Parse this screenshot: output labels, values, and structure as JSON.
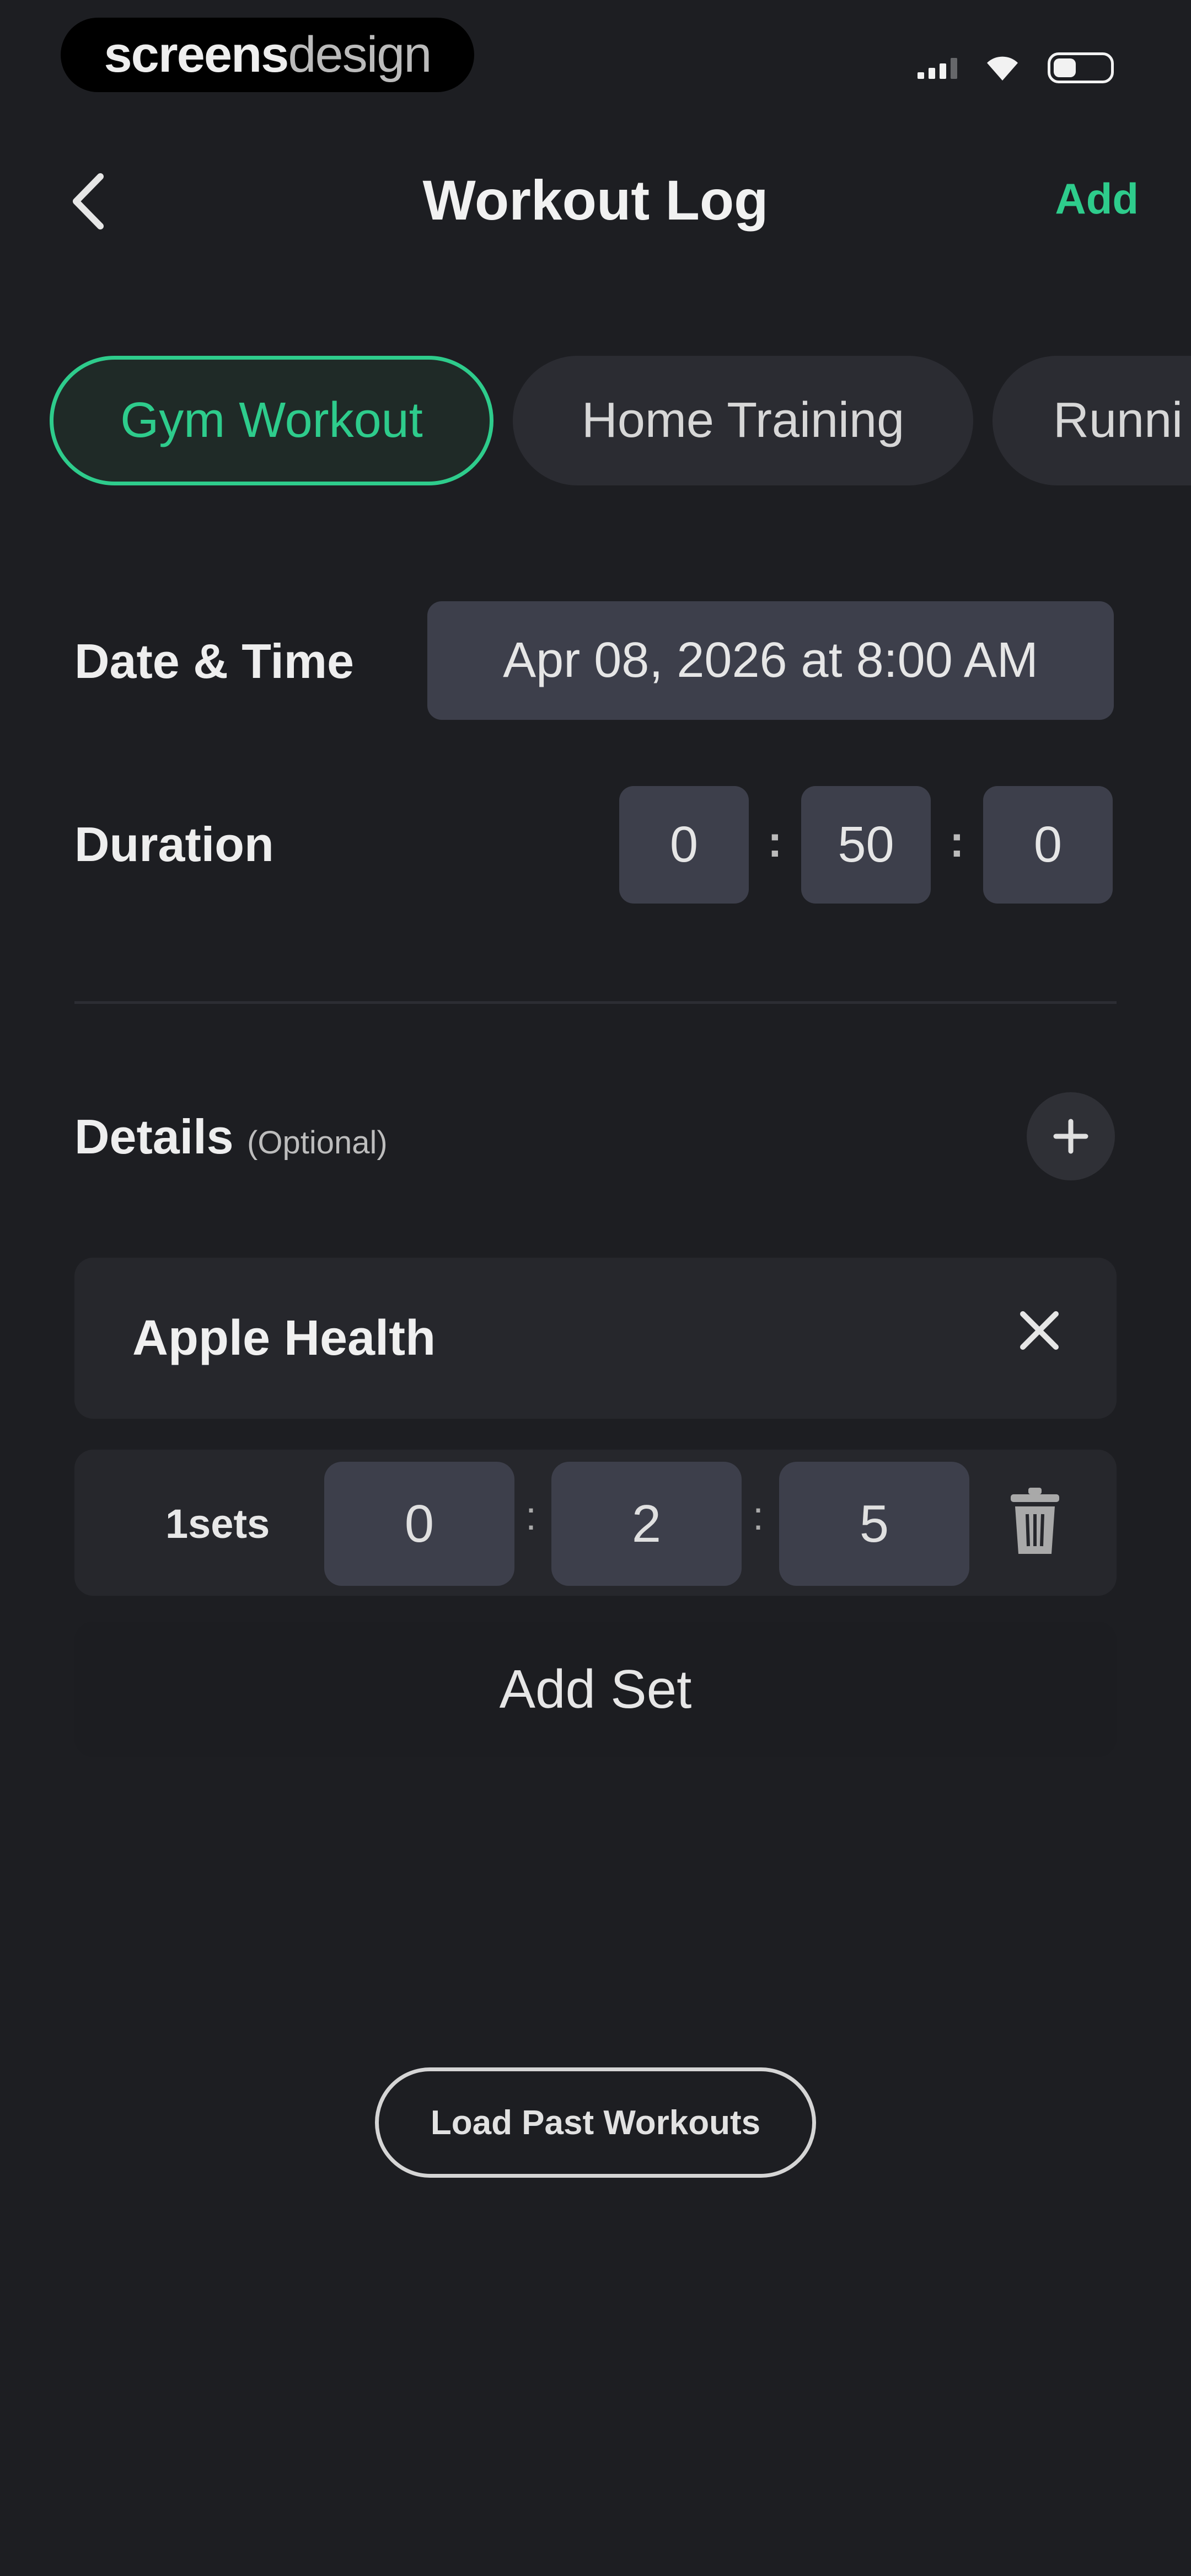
{
  "status_bar": {
    "badge_bold": "screens",
    "badge_light": "design",
    "wifi_icon": "wifi-icon",
    "signal_icon": "cellular-signal-icon",
    "battery_icon": "battery-icon"
  },
  "header": {
    "back_icon": "chevron-left-icon",
    "title": "Workout Log",
    "add_label": "Add"
  },
  "tabs": [
    {
      "label": "Gym Workout",
      "active": true
    },
    {
      "label": "Home Training",
      "active": false
    },
    {
      "label": "Runni",
      "active": false
    }
  ],
  "form": {
    "date_label": "Date & Time",
    "date_value": "Apr 08, 2026 at 8:00 AM",
    "duration_label": "Duration",
    "duration": {
      "hours": "0",
      "minutes": "50",
      "seconds": "0"
    },
    "separator": ":"
  },
  "details": {
    "label": "Details",
    "optional": "(Optional)",
    "add_icon": "plus-icon",
    "card_title": "Apple Health",
    "close_icon": "close-icon",
    "set": {
      "label": "1sets",
      "values": [
        "0",
        "2",
        "5"
      ],
      "delete_icon": "trash-icon"
    },
    "add_set_label": "Add Set"
  },
  "footer": {
    "load_past_label": "Load Past Workouts"
  },
  "colors": {
    "background": "#1d1e22",
    "accent": "#2ecc8c",
    "chip": "#3d3f4b",
    "card": "#26272c"
  }
}
